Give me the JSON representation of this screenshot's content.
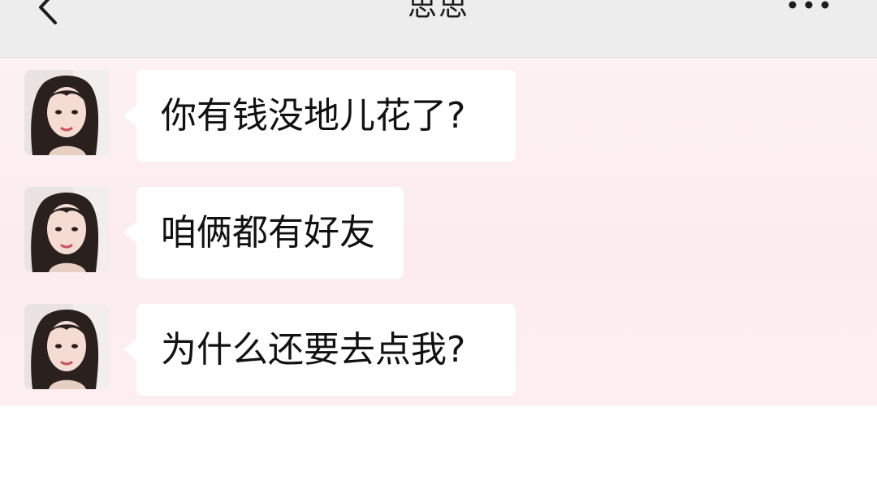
{
  "header": {
    "title": "思思",
    "back_icon": "chevron-left-icon",
    "more_icon": "more-dots-icon"
  },
  "messages": [
    {
      "text": "你有钱没地儿花了?",
      "sender": "contact"
    },
    {
      "text": "咱俩都有好友",
      "sender": "contact"
    },
    {
      "text": "为什么还要去点我?",
      "sender": "contact"
    }
  ],
  "colors": {
    "nav_bg": "#ededed",
    "chat_bg": "#fdf1f3",
    "bubble_bg": "#ffffff",
    "text": "#111111"
  }
}
